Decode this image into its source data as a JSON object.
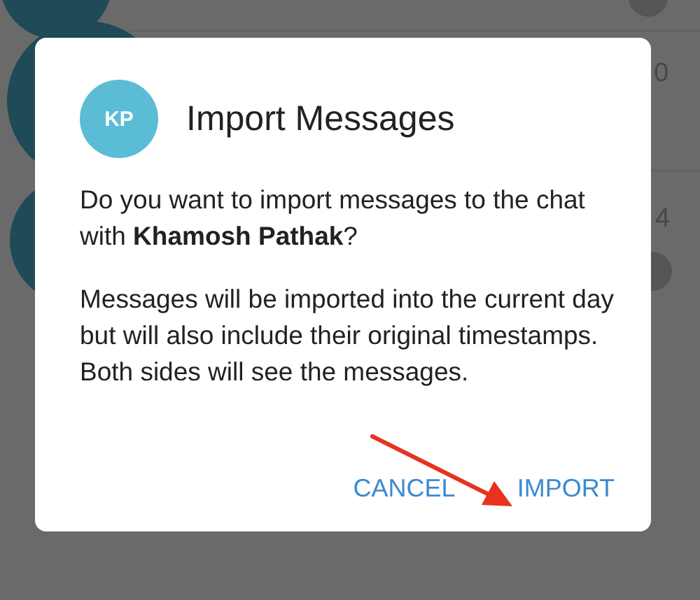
{
  "background": {
    "times": [
      "0",
      "4"
    ]
  },
  "dialog": {
    "avatar_initials": "KP",
    "title": "Import Messages",
    "paragraphs": [
      "Do you want to import messages to the chat with **Khamosh Pathak**?",
      "Messages will be imported into the current day but will also include their original timestamps. Both sides will see the messages."
    ],
    "buttons": [
      "CANCEL",
      "IMPORT"
    ]
  }
}
